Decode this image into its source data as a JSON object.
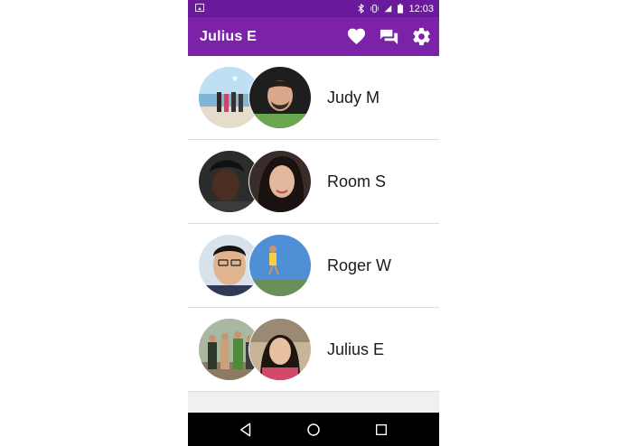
{
  "status_bar": {
    "time": "12:03"
  },
  "app_bar": {
    "title": "Julius E",
    "actions": [
      "heart-icon",
      "chat-icon",
      "settings-icon"
    ]
  },
  "conversations": [
    {
      "name": "Judy M"
    },
    {
      "name": "Room S"
    },
    {
      "name": "Roger W"
    },
    {
      "name": "Julius E"
    }
  ],
  "nav_bar": {
    "buttons": [
      "back-icon",
      "home-icon",
      "recents-icon"
    ]
  },
  "colors": {
    "status_bar": "#6a1a9a",
    "app_bar": "#7b22a8",
    "divider": "#dddddd"
  }
}
